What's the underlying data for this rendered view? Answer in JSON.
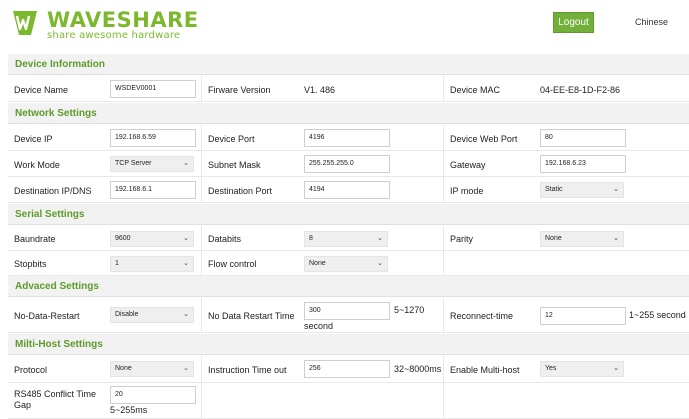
{
  "header": {
    "brand": "WAVESHARE",
    "tagline": "share awesome hardware",
    "logout_label": "Logout",
    "language_label": "Chinese",
    "logo_icon": "waveshare-logo-icon",
    "accent": "#7cb82e"
  },
  "device": {
    "title": "Device Information",
    "name_label": "Device Name",
    "name_value": "WSDEV0001",
    "fw_label": "Firware Version",
    "fw_value": "V1. 486",
    "mac_label": "Device MAC",
    "mac_value": "04-EE-E8-1D-F2-86"
  },
  "network": {
    "title": "Network Settings",
    "ip_label": "Device IP",
    "ip_value": "192.168.6.59",
    "port_label": "Device Port",
    "port_value": "4196",
    "webport_label": "Device Web Port",
    "webport_value": "80",
    "workmode_label": "Work Mode",
    "workmode_value": "TCP Server",
    "mask_label": "Subnet Mask",
    "mask_value": "255.255.255.0",
    "gateway_label": "Gateway",
    "gateway_value": "192.168.6.23",
    "destip_label": "Destination IP/DNS",
    "destip_value": "192.168.6.1",
    "destport_label": "Destination Port",
    "destport_value": "4194",
    "ipmode_label": "IP mode",
    "ipmode_value": "Static"
  },
  "serial": {
    "title": "Serial Settings",
    "baud_label": "Baundrate",
    "baud_value": "9600",
    "databits_label": "Databits",
    "databits_value": "8",
    "parity_label": "Parity",
    "parity_value": "None",
    "stopbits_label": "Stopbits",
    "stopbits_value": "1",
    "flow_label": "Flow control",
    "flow_value": "None"
  },
  "advanced": {
    "title": "Advaced Settings",
    "ndr_label": "No-Data-Restart",
    "ndr_value": "Disable",
    "ndrtime_label": "No Data Restart Time",
    "ndrtime_value": "300",
    "ndrtime_hint": "5~1270",
    "ndrtime_unit": "second",
    "reconnect_label": "Reconnect-time",
    "reconnect_value": "12",
    "reconnect_hint": "1~255 second"
  },
  "multihost": {
    "title": "Milti-Host Settings",
    "protocol_label": "Protocol",
    "protocol_value": "None",
    "timeout_label": "Instruction Time out",
    "timeout_value": "256",
    "timeout_hint": "32~8000ms",
    "enable_label": "Enable Multi-host",
    "enable_value": "Yes",
    "gap_label_1": "RS485 Conflict Time",
    "gap_label_2": "Gap",
    "gap_value": "20",
    "gap_hint": "5~255ms"
  }
}
